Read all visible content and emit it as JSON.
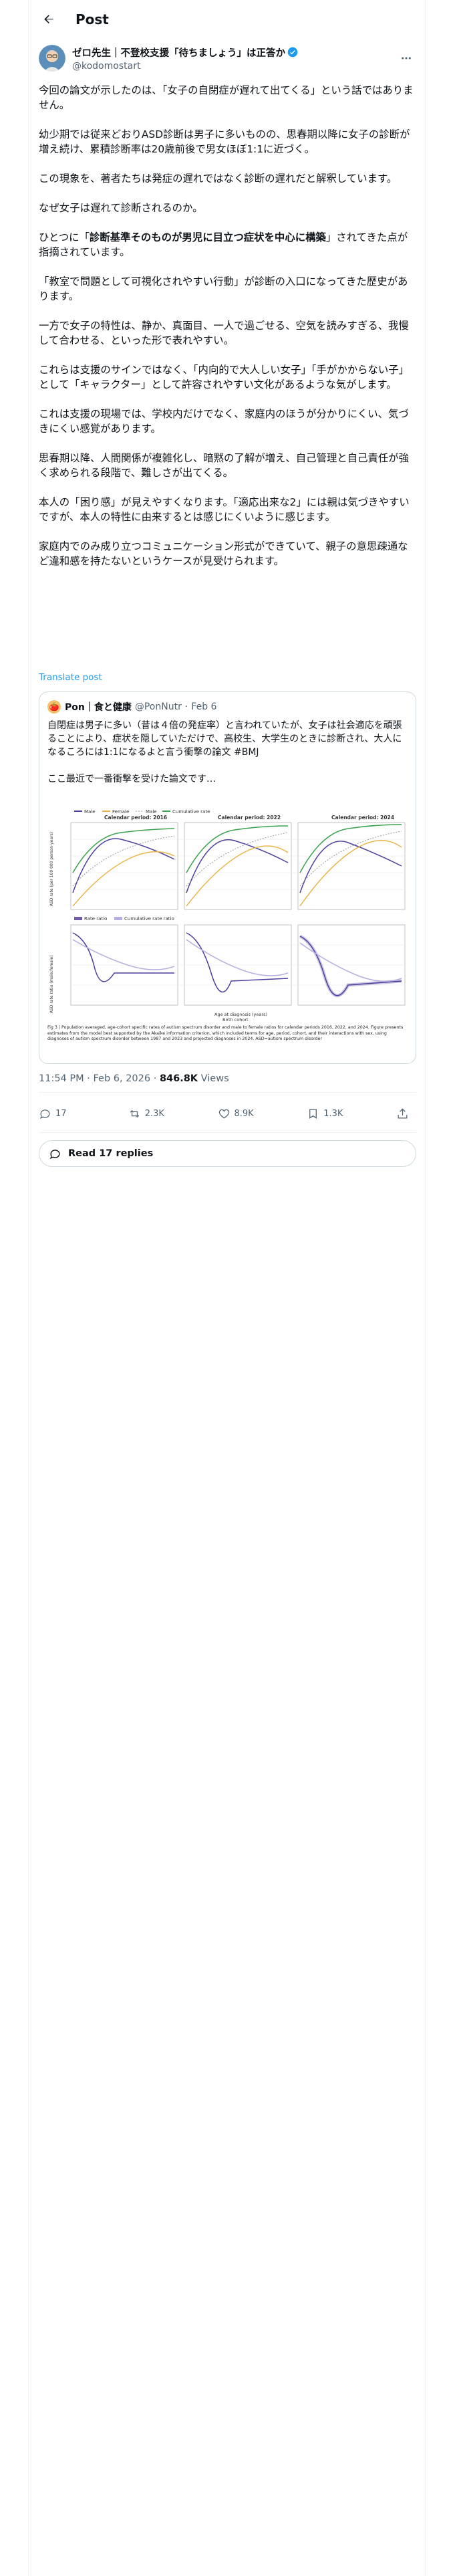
{
  "header": {
    "title": "Post"
  },
  "author": {
    "name": "ゼロ先生｜不登校支援「待ちましょう」は正答か",
    "handle": "@kodomostart"
  },
  "post": {
    "paragraphs": [
      "今回の論文が示したのは、「女子の自閉症が遅れて出てくる」という話ではありません。",
      "幼少期では従来どおりASD診断は男子に多いものの、思春期以降に女子の診断が増え続け、累積診断率は20歳前後で男女ほぼ1:1に近づく。",
      "この現象を、著者たちは発症の遅れではなく診断の遅れだと解釈しています。",
      "なぜ女子は遅れて診断されるのか。"
    ],
    "p5_pre": "ひとつに「",
    "p5_bold": "診断基準そのものが男児に目立つ症状を中心に構築",
    "p5_post": "」されてきた点が指摘されています。",
    "paragraphs_b": [
      "「教室で問題として可視化されやすい行動」が診断の入口になってきた歴史があります。",
      "一方で女子の特性は、静か、真面目、一人で過ごせる、空気を読みすぎる、我慢して合わせる、といった形で表れやすい。",
      "これらは支援のサインではなく、「内向的で大人しい女子」「手がかからない子」として「キャラクター」として許容されやすい文化があるような気がします。",
      "これは支援の現場では、学校内だけでなく、家庭内のほうが分かりにくい、気づきにくい感覚があります。",
      "思春期以降、人間関係が複雑化し、暗黙の了解が増え、自己管理と自己責任が強く求められる段階で、難しさが出てくる。",
      "本人の「困り感」が見えやすくなります。「適応出来な2」には親は気づきやすいですが、本人の特性に由来するとは感じにくいように感じます。",
      "家庭内でのみ成り立つコミュニケーション形式ができていて、親子の意思疎通など違和感を持たないというケースが見受けられます。"
    ],
    "translate_label": "Translate post"
  },
  "quote": {
    "name": "Pon｜食と健康",
    "handle": "@PonNutr",
    "date": "Feb 6",
    "text": "自閉症は男子に多い（昔は４倍の発症率）と言われていたが、女子は社会適応を頑張ることにより、症状を隠していただけで、高校生、大学生のときに診断され、大人になるころには1:1になるよと言う衝撃の論文 #BMJ\n\nここ最近で一番衝撃を受けた論文です…",
    "legend_top": [
      "Male",
      "Female",
      "Male",
      "Cumulative rate"
    ],
    "legend_bottom": [
      "Rate ratio",
      "Cumulative rate ratio"
    ],
    "panel_titles": [
      "Calendar period: 2016",
      "Calendar period: 2022",
      "Calendar period: 2024"
    ],
    "y_top_label": "ASD rate (per 100 000 person-years)",
    "y_bottom_label": "ASD rate ratio (male:female)",
    "x_label": "Age at diagnosis (years)",
    "x_label2": "Birth cohort",
    "caption": "Fig 3 | Population averaged, age-cohort specific rates of autism spectrum disorder and male to female ratios for calendar periods 2016, 2022, and 2024. Figure presents estimates from the model best supported by the Akaike information criterion, which included terms for age, period, cohort, and their interactions with sex, using diagnoses of autism spectrum disorder between 1987 and 2023 and projected diagnoses in 2024. ASD=autism spectrum disorder"
  },
  "meta": {
    "time": "11:54 PM · Feb 6, 2026 · ",
    "views_count": "846.8K",
    "views_label": " Views"
  },
  "actions": {
    "replies": "17",
    "reposts": "2.3K",
    "likes": "8.9K",
    "bookmarks": "1.3K"
  },
  "read_replies": "Read 17 replies",
  "colors": {
    "accent": "#1d9bf0",
    "male": "#4b3e9e",
    "female": "#e8b64a",
    "cumulative": "#3aa14c",
    "ratio": "#6f5ba8"
  }
}
